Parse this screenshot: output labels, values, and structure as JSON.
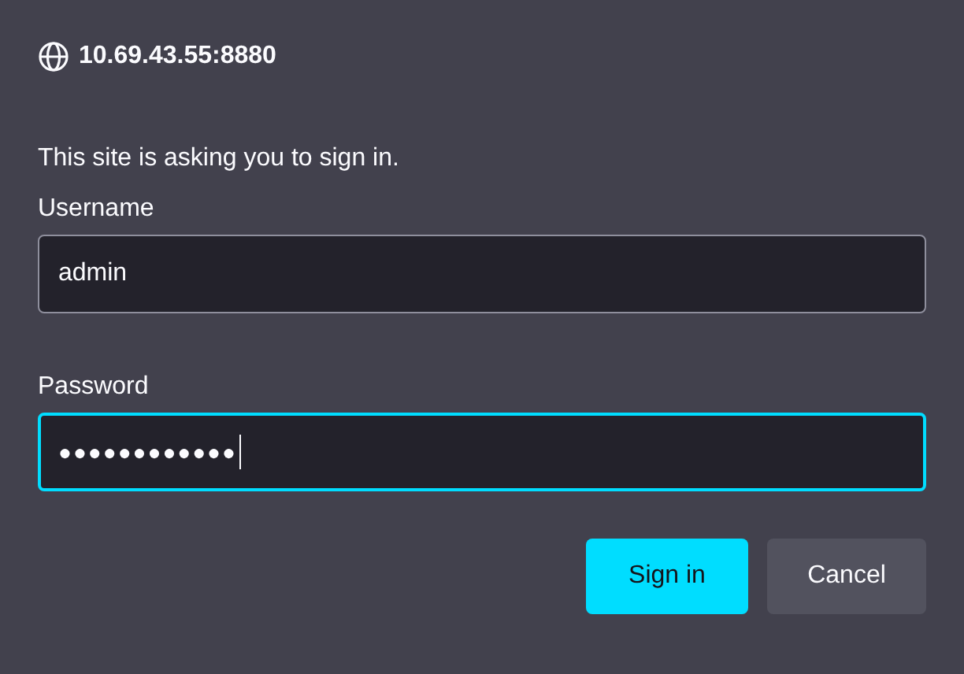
{
  "dialog": {
    "site": "10.69.43.55:8880",
    "message": "This site is asking you to sign in."
  },
  "fields": [
    {
      "label": "Username",
      "value": "admin",
      "focused": false
    },
    {
      "label": "Password",
      "value": "●●●●●●●●●●●●",
      "focused": true
    }
  ],
  "buttons": [
    {
      "label": "Sign in",
      "kind": "primary"
    },
    {
      "label": "Cancel",
      "kind": "secondary"
    }
  ]
}
